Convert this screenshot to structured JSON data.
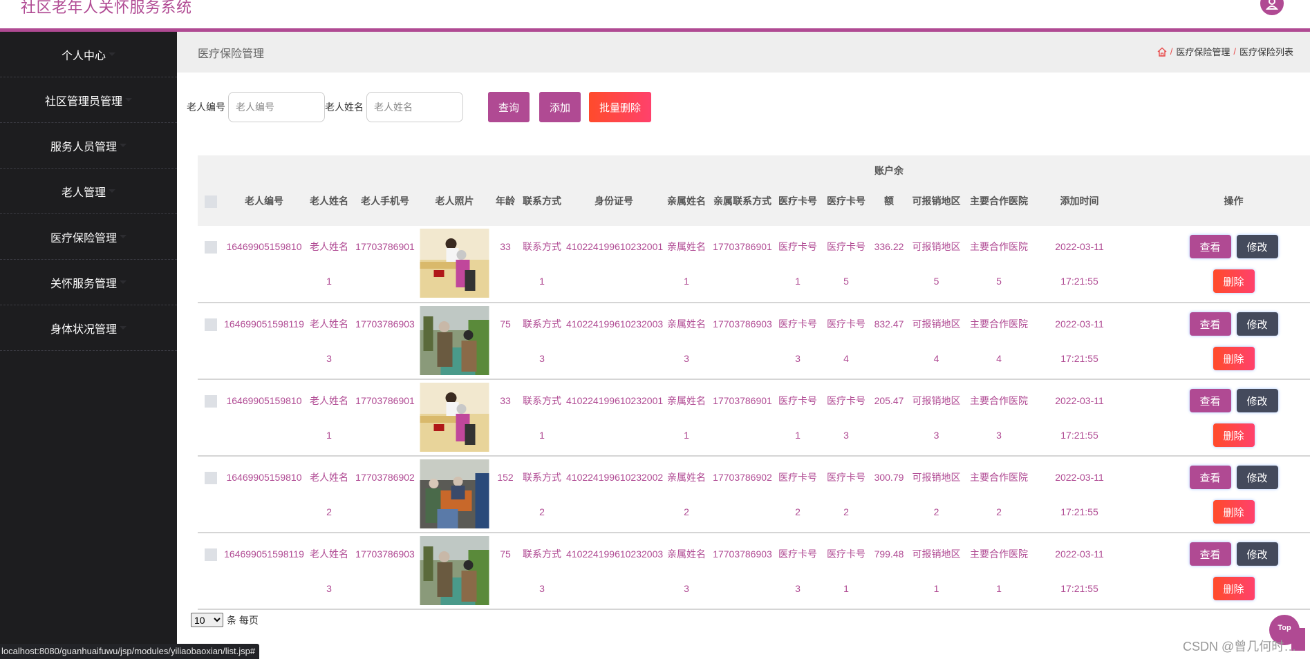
{
  "header": {
    "app_title": "社区老年人关怀服务系统",
    "avatar_icon": "user-icon"
  },
  "sidebar": {
    "items": [
      {
        "label": "个人中心"
      },
      {
        "label": "社区管理员管理"
      },
      {
        "label": "服务人员管理"
      },
      {
        "label": "老人管理"
      },
      {
        "label": "医疗保险管理"
      },
      {
        "label": "关怀服务管理"
      },
      {
        "label": "身体状况管理"
      }
    ]
  },
  "page": {
    "title": "医疗保险管理",
    "breadcrumb": [
      "医疗保险管理",
      "医疗保险列表"
    ],
    "breadcrumb_sep": "/"
  },
  "search": {
    "field1_label": "老人编号",
    "field1_placeholder": "老人编号",
    "field1_value": "",
    "field2_label": "老人姓名",
    "field2_placeholder": "老人姓名",
    "field2_value": "",
    "query_label": "查询",
    "add_label": "添加",
    "batch_delete_label": "批量删除"
  },
  "table": {
    "columns": [
      "",
      "老人编号",
      "老人姓名",
      "老人手机号",
      "老人照片",
      "年龄",
      "联系方式",
      "身份证号",
      "亲属姓名",
      "亲属联系方式",
      "医疗卡号",
      "医疗卡号",
      "账户余额",
      "可报销地区",
      "主要合作医院",
      "添加时间",
      "操作"
    ],
    "balance_header_line1": "账户余",
    "balance_header_line2": "额",
    "rows": [
      {
        "id": "16469905159810",
        "name": "老人姓名1",
        "name_a": "老人姓名",
        "name_b": "1",
        "phone": "17703786901",
        "photo": "elder-photo-1",
        "age": "33",
        "contact_a": "联系方式",
        "contact_b": "1",
        "idcard": "410224199610232001",
        "rel_a": "亲属姓名",
        "rel_b": "1",
        "rel_phone": "17703786901",
        "card1_a": "医疗卡号",
        "card1_b": "1",
        "card2_a": "医疗卡号",
        "card2_b": "5",
        "balance": "336.22",
        "area_a": "可报销地区",
        "area_b": "5",
        "hosp_a": "主要合作医院",
        "hosp_b": "5",
        "date": "2022-03-11",
        "time": "17:21:55"
      },
      {
        "id": "164699051598119",
        "name": "老人姓名3",
        "name_a": "老人姓名",
        "name_b": "3",
        "phone": "17703786903",
        "photo": "elder-photo-2",
        "age": "75",
        "contact_a": "联系方式",
        "contact_b": "3",
        "idcard": "410224199610232003",
        "rel_a": "亲属姓名",
        "rel_b": "3",
        "rel_phone": "17703786903",
        "card1_a": "医疗卡号",
        "card1_b": "3",
        "card2_a": "医疗卡号",
        "card2_b": "4",
        "balance": "832.47",
        "area_a": "可报销地区",
        "area_b": "4",
        "hosp_a": "主要合作医院",
        "hosp_b": "4",
        "date": "2022-03-11",
        "time": "17:21:55"
      },
      {
        "id": "16469905159810",
        "name": "老人姓名1",
        "name_a": "老人姓名",
        "name_b": "1",
        "phone": "17703786901",
        "photo": "elder-photo-1",
        "age": "33",
        "contact_a": "联系方式",
        "contact_b": "1",
        "idcard": "410224199610232001",
        "rel_a": "亲属姓名",
        "rel_b": "1",
        "rel_phone": "17703786901",
        "card1_a": "医疗卡号",
        "card1_b": "1",
        "card2_a": "医疗卡号",
        "card2_b": "3",
        "balance": "205.47",
        "area_a": "可报销地区",
        "area_b": "3",
        "hosp_a": "主要合作医院",
        "hosp_b": "3",
        "date": "2022-03-11",
        "time": "17:21:55"
      },
      {
        "id": "16469905159810",
        "name": "老人姓名2",
        "name_a": "老人姓名",
        "name_b": "2",
        "phone": "17703786902",
        "photo": "elder-photo-3",
        "age": "152",
        "contact_a": "联系方式",
        "contact_b": "2",
        "idcard": "410224199610232002",
        "rel_a": "亲属姓名",
        "rel_b": "2",
        "rel_phone": "17703786902",
        "card1_a": "医疗卡号",
        "card1_b": "2",
        "card2_a": "医疗卡号",
        "card2_b": "2",
        "balance": "300.79",
        "area_a": "可报销地区",
        "area_b": "2",
        "hosp_a": "主要合作医院",
        "hosp_b": "2",
        "date": "2022-03-11",
        "time": "17:21:55"
      },
      {
        "id": "164699051598119",
        "name": "老人姓名3",
        "name_a": "老人姓名",
        "name_b": "3",
        "phone": "17703786903",
        "photo": "elder-photo-2",
        "age": "75",
        "contact_a": "联系方式",
        "contact_b": "3",
        "idcard": "410224199610232003",
        "rel_a": "亲属姓名",
        "rel_b": "3",
        "rel_phone": "17703786903",
        "card1_a": "医疗卡号",
        "card1_b": "3",
        "card2_a": "医疗卡号",
        "card2_b": "1",
        "balance": "799.48",
        "area_a": "可报销地区",
        "area_b": "1",
        "hosp_a": "主要合作医院",
        "hosp_b": "1",
        "date": "2022-03-11",
        "time": "17:21:55"
      }
    ],
    "actions": {
      "view": "查看",
      "edit": "修改",
      "delete": "删除"
    }
  },
  "pager": {
    "page_size": "10",
    "suffix": "条 每页"
  },
  "status_bar": {
    "url": "localhost:8080/guanhuaifuwu/jsp/modules/yiliaobaoxian/list.jsp#"
  },
  "top_button": {
    "label": "Top"
  },
  "watermark": "CSDN @曾几何时…",
  "colors": {
    "accent": "#b04a93",
    "sidebar_bg": "#1d1d1f",
    "edit_button": "#444a5c",
    "delete_gradient_start": "#ff4b2b",
    "delete_gradient_end": "#ff416c"
  }
}
